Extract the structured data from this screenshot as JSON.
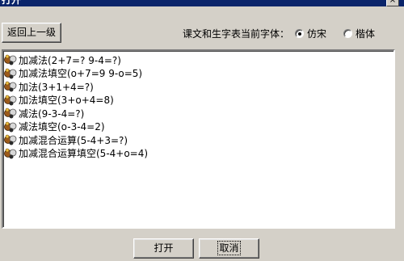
{
  "window": {
    "title": "打开",
    "close_glyph": "×"
  },
  "back_button": "返回上一级",
  "font_setting": {
    "label": "课文和生字表当前字体：",
    "options": [
      {
        "label": "仿宋",
        "selected": true
      },
      {
        "label": "楷体",
        "selected": false
      }
    ]
  },
  "items": [
    "加减法(2+7=?  9-4=?)",
    "加减法填空(o+7=9  9-o=5)",
    "加法(3+1+4=?)",
    "加法填空(3+o+4=8)",
    "减法(9-3-4=?)",
    "减法填空(o-3-4=2)",
    "加减混合运算(5-4+3=?)",
    "加减混合运算填空(5-4+o=4)"
  ],
  "buttons": {
    "open": "打开",
    "cancel": "取消"
  }
}
